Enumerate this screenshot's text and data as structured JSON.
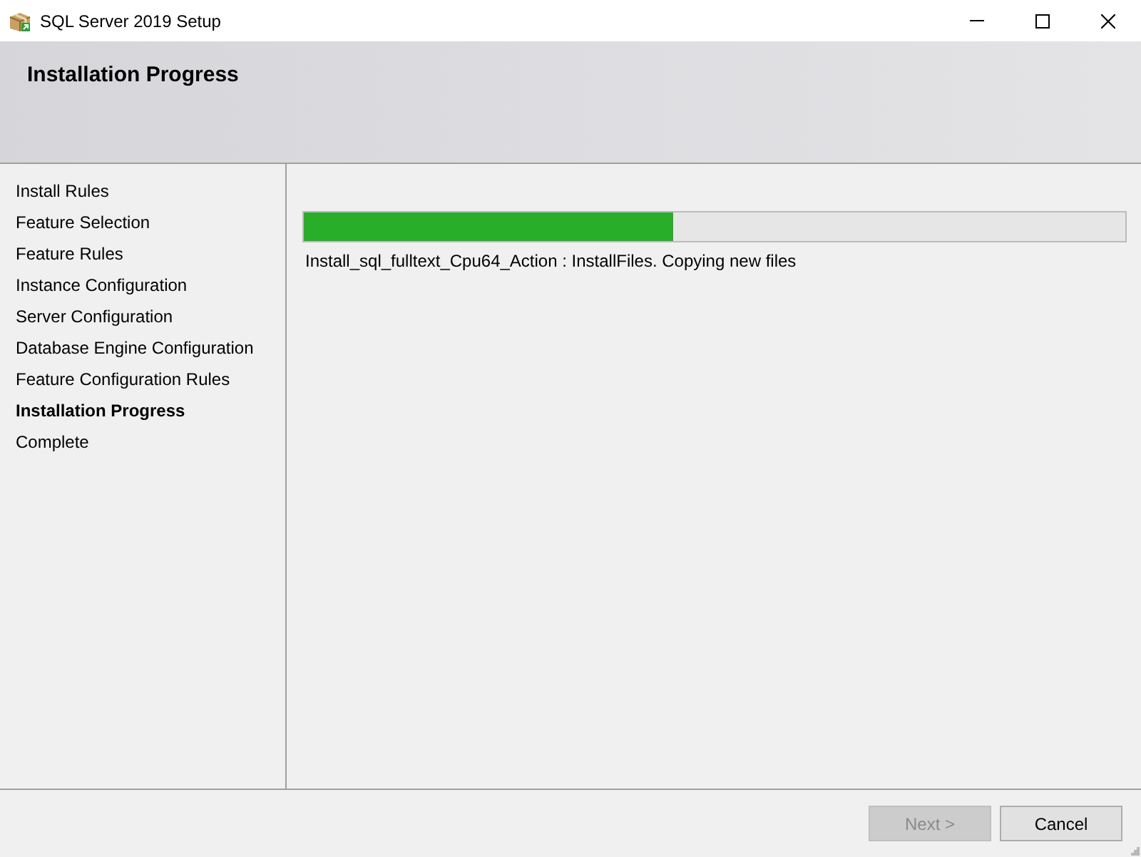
{
  "window": {
    "title": "SQL Server 2019 Setup"
  },
  "header": {
    "title": "Installation Progress"
  },
  "steps": [
    {
      "label": "Install Rules",
      "selected": false
    },
    {
      "label": "Feature Selection",
      "selected": false
    },
    {
      "label": "Feature Rules",
      "selected": false
    },
    {
      "label": "Instance Configuration",
      "selected": false
    },
    {
      "label": "Server Configuration",
      "selected": false
    },
    {
      "label": "Database Engine Configuration",
      "selected": false
    },
    {
      "label": "Feature Configuration Rules",
      "selected": false
    },
    {
      "label": "Installation Progress",
      "selected": true
    },
    {
      "label": "Complete",
      "selected": false
    }
  ],
  "progress": {
    "level": 0.45,
    "status": "Install_sql_fulltext_Cpu64_Action : InstallFiles. Copying new files"
  },
  "buttons": [
    {
      "label": "Next >",
      "disabled": true
    },
    {
      "label": "Cancel",
      "disabled": false
    }
  ]
}
